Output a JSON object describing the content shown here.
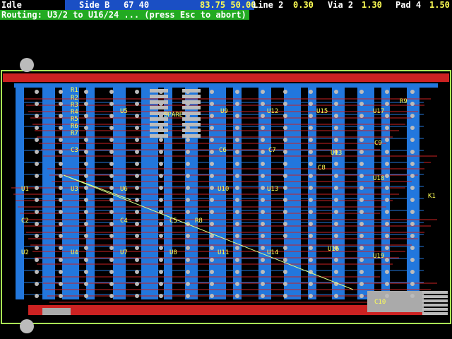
{
  "status": {
    "mode": "Idle",
    "side_label": "Side B",
    "coords_a": "67  40",
    "coords_b": "83.75  50.00",
    "line_label": "Line 2",
    "line_value": "0.30",
    "via_label": "Via 2",
    "via_value": "1.30",
    "pad_label": "Pad 4",
    "pad_value": "1.50"
  },
  "routing_message": "Routing: U3/2 to U16/24 ... (press Esc to abort)",
  "colors": {
    "background": "#000000",
    "board_outline": "#aaff55",
    "copper_top": "#cc2222",
    "copper_bottom": "#2277dd",
    "pads": "#bbbbbb",
    "labels": "#ffff55",
    "ratsnest": "#ddff88",
    "routing_bar": "#22aa22",
    "status_accent": "#1a4fc4"
  },
  "components": [
    {
      "ref": "R1"
    },
    {
      "ref": "R2"
    },
    {
      "ref": "R3"
    },
    {
      "ref": "R4"
    },
    {
      "ref": "R5"
    },
    {
      "ref": "R6"
    },
    {
      "ref": "R7"
    },
    {
      "ref": "U5"
    },
    {
      "ref": "SPARE"
    },
    {
      "ref": "U9"
    },
    {
      "ref": "U12"
    },
    {
      "ref": "U15"
    },
    {
      "ref": "U17"
    },
    {
      "ref": "R9"
    },
    {
      "ref": "C3"
    },
    {
      "ref": "C6"
    },
    {
      "ref": "C7"
    },
    {
      "ref": "U13"
    },
    {
      "ref": "C9"
    },
    {
      "ref": "C8"
    },
    {
      "ref": "U1"
    },
    {
      "ref": "U3"
    },
    {
      "ref": "U6"
    },
    {
      "ref": "U10"
    },
    {
      "ref": "U13"
    },
    {
      "ref": "U18"
    },
    {
      "ref": "K1"
    },
    {
      "ref": "C2"
    },
    {
      "ref": "C4"
    },
    {
      "ref": "C5"
    },
    {
      "ref": "R8"
    },
    {
      "ref": "U2"
    },
    {
      "ref": "U4"
    },
    {
      "ref": "U7"
    },
    {
      "ref": "U8"
    },
    {
      "ref": "U11"
    },
    {
      "ref": "U14"
    },
    {
      "ref": "U16"
    },
    {
      "ref": "U19"
    },
    {
      "ref": "C10"
    }
  ]
}
